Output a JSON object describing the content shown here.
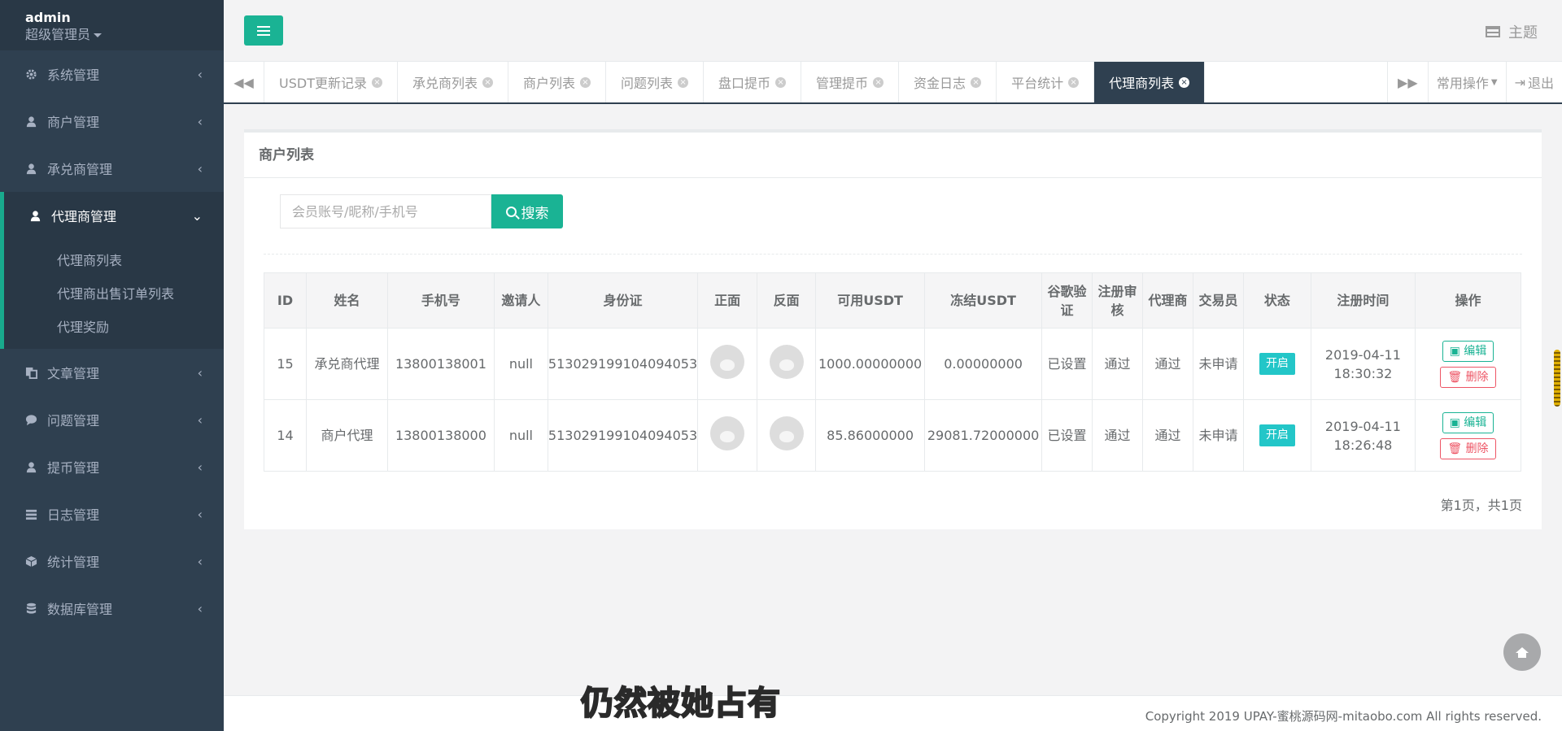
{
  "profile": {
    "name": "admin",
    "role": "超级管理员"
  },
  "sidebar": {
    "items": [
      {
        "label": "系统管理"
      },
      {
        "label": "商户管理"
      },
      {
        "label": "承兑商管理"
      },
      {
        "label": "代理商管理",
        "active": true,
        "children": [
          "代理商列表",
          "代理商出售订单列表",
          "代理奖励"
        ]
      },
      {
        "label": "文章管理"
      },
      {
        "label": "问题管理"
      },
      {
        "label": "提币管理"
      },
      {
        "label": "日志管理"
      },
      {
        "label": "统计管理"
      },
      {
        "label": "数据库管理"
      }
    ]
  },
  "topbar": {
    "theme_label": "主题"
  },
  "tabs": [
    "USDT更新记录",
    "承兑商列表",
    "商户列表",
    "问题列表",
    "盘口提币",
    "管理提币",
    "资金日志",
    "平台统计",
    "代理商列表"
  ],
  "tab_actions": {
    "common_ops": "常用操作",
    "logout": "退出"
  },
  "panel": {
    "title": "商户列表",
    "search_placeholder": "会员账号/昵称/手机号",
    "search_button": "搜索",
    "table": {
      "headers": [
        "ID",
        "姓名",
        "手机号",
        "邀请人",
        "身份证",
        "正面",
        "反面",
        "可用USDT",
        "冻结USDT",
        "谷歌验证",
        "注册审核",
        "代理商",
        "交易员",
        "状态",
        "注册时间",
        "操作"
      ],
      "rows": [
        {
          "id": "15",
          "name": "承兑商代理",
          "phone": "13800138001",
          "inviter": "null",
          "idcard": "513029199104094053",
          "usdt": "1000.00000000",
          "frozen": "0.00000000",
          "google": "已设置",
          "audit": "通过",
          "agent": "通过",
          "trader": "未申请",
          "status": "开启",
          "date": "2019-04-11",
          "time": "18:30:32"
        },
        {
          "id": "14",
          "name": "商户代理",
          "phone": "13800138000",
          "inviter": "null",
          "idcard": "513029199104094053",
          "usdt": "85.86000000",
          "frozen": "29081.72000000",
          "google": "已设置",
          "audit": "通过",
          "agent": "通过",
          "trader": "未申请",
          "status": "开启",
          "date": "2019-04-11",
          "time": "18:26:48"
        }
      ],
      "edit_label": "编辑",
      "delete_label": "删除"
    },
    "pager": "第1页，共1页"
  },
  "footer": {
    "copyright": "Copyright 2019 UPAY-蜜桃源码网-mitaobo.com All rights reserved."
  },
  "overlay_subtitle": "仍然被她占有",
  "colors": {
    "sidebar": "#2f4050",
    "accent": "#1ab394",
    "badge": "#23c6c8",
    "danger": "#ed5565"
  }
}
